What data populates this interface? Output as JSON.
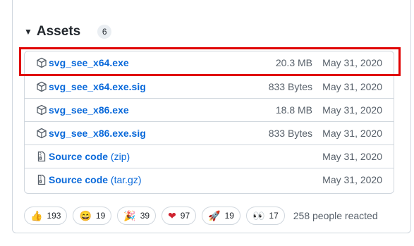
{
  "assets": {
    "title": "Assets",
    "count": "6",
    "items": [
      {
        "name": "svg_see_x64.exe",
        "suffix": "",
        "size": "20.3 MB",
        "date": "May 31, 2020",
        "icon": "package-icon"
      },
      {
        "name": "svg_see_x64.exe.sig",
        "suffix": "",
        "size": "833 Bytes",
        "date": "May 31, 2020",
        "icon": "package-icon"
      },
      {
        "name": "svg_see_x86.exe",
        "suffix": "",
        "size": "18.8 MB",
        "date": "May 31, 2020",
        "icon": "package-icon"
      },
      {
        "name": "svg_see_x86.exe.sig",
        "suffix": "",
        "size": "833 Bytes",
        "date": "May 31, 2020",
        "icon": "package-icon"
      },
      {
        "name": "Source code",
        "suffix": " (zip)",
        "size": "",
        "date": "May 31, 2020",
        "icon": "file-zip-icon"
      },
      {
        "name": "Source code",
        "suffix": " (tar.gz)",
        "size": "",
        "date": "May 31, 2020",
        "icon": "file-zip-icon"
      }
    ]
  },
  "reactions": {
    "items": [
      {
        "emoji": "👍",
        "count": "193",
        "icon": "thumbs-up-icon"
      },
      {
        "emoji": "😄",
        "count": "19",
        "icon": "laugh-icon"
      },
      {
        "emoji": "🎉",
        "count": "39",
        "icon": "hooray-icon"
      },
      {
        "emoji": "❤",
        "count": "97",
        "icon": "heart-icon"
      },
      {
        "emoji": "🚀",
        "count": "19",
        "icon": "rocket-icon"
      },
      {
        "emoji": "👀",
        "count": "17",
        "icon": "eyes-icon"
      }
    ],
    "summary": "258 people reacted"
  },
  "colors": {
    "link": "#0969da",
    "highlight": "#e00000",
    "muted": "#57606a"
  }
}
